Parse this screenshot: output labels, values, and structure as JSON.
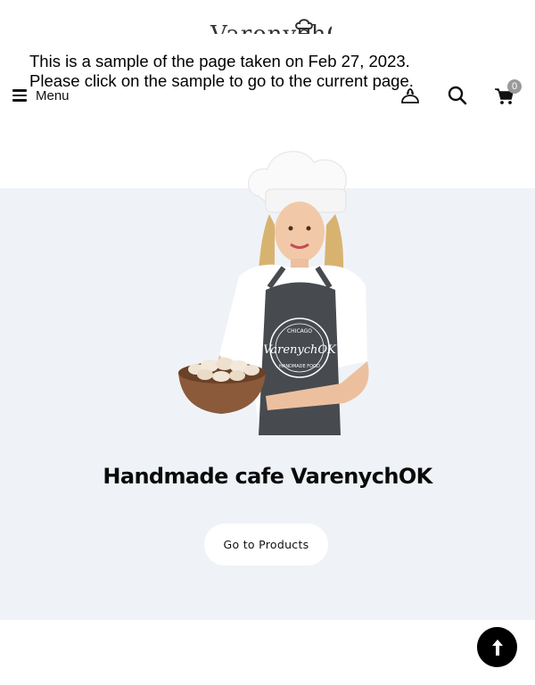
{
  "brand": {
    "logo_text": "VarenychOK"
  },
  "notice": {
    "line1": "This is a sample of the page taken on Feb 27, 2023.",
    "line2": "Please click on the sample to go to the current page."
  },
  "header": {
    "menu_label": "Menu",
    "cart_count": "0",
    "icons": [
      "menu-icon",
      "dumpling-icon",
      "search-icon",
      "cart-icon"
    ]
  },
  "hero": {
    "title": "Handmade cafe VarenychOK",
    "cta_label": "Go to Products",
    "apron_logo": {
      "top": "CHICAGO",
      "main": "VarenychOK",
      "bottom": "HANDMADE FOOD"
    }
  },
  "colors": {
    "hero_bg": "#eff3f8",
    "badge": "#9a9a9a",
    "button_bg": "#ffffff",
    "to_top_bg": "#000000"
  }
}
